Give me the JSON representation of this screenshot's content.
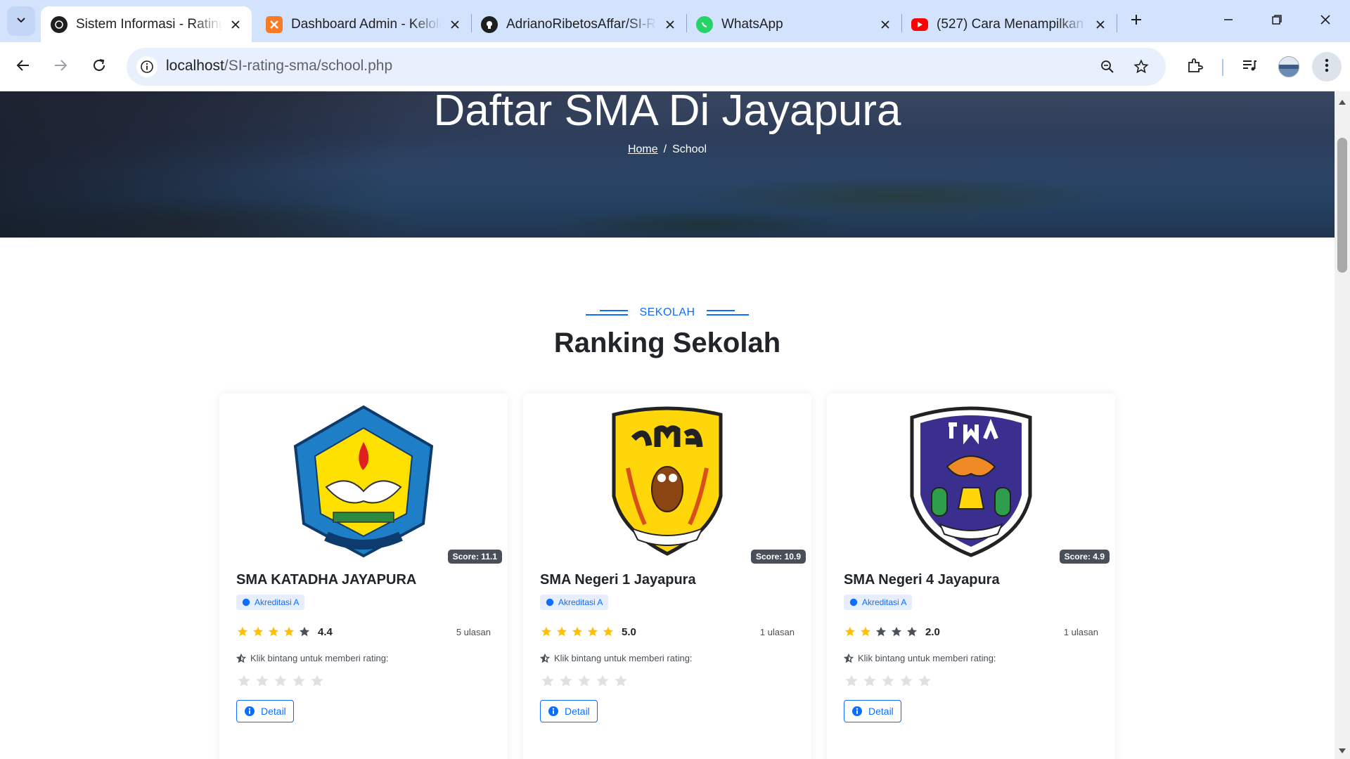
{
  "tabs": [
    {
      "title": "Sistem Informasi - Rating",
      "favicon": "page-icon",
      "active": true
    },
    {
      "title": "Dashboard Admin - Kelola",
      "favicon": "xampp-icon",
      "active": false
    },
    {
      "title": "AdrianoRibetosAffar/SI-R",
      "favicon": "github-icon",
      "active": false
    },
    {
      "title": "WhatsApp",
      "favicon": "whatsapp-icon",
      "active": false
    },
    {
      "title": "(527) Cara Menampilkan",
      "favicon": "youtube-icon",
      "active": false
    }
  ],
  "address": {
    "host": "localhost",
    "path": "/SI-rating-sma/school.php"
  },
  "hero": {
    "title": "Daftar SMA Di Jayapura",
    "breadcrumb": {
      "home": "Home",
      "separator": "/",
      "current": "School"
    }
  },
  "section": {
    "subtitle": "SEKOLAH",
    "title": "Ranking Sekolah"
  },
  "schools": [
    {
      "name": "SMA KATADHA JAYAPURA",
      "score": "Score: 11.1",
      "accreditation": "Akreditasi A",
      "rating": "4.4",
      "rating_value": 4.4,
      "reviews": "5 ulasan",
      "rate_hint": "Klik bintang untuk memberi rating:",
      "detail": "Detail",
      "logo": "sma-katadha-logo"
    },
    {
      "name": "SMA Negeri 1 Jayapura",
      "score": "Score: 10.9",
      "accreditation": "Akreditasi A",
      "rating": "5.0",
      "rating_value": 5.0,
      "reviews": "1 ulasan",
      "rate_hint": "Klik bintang untuk memberi rating:",
      "detail": "Detail",
      "logo": "sma-negeri-1-logo"
    },
    {
      "name": "SMA Negeri 4 Jayapura",
      "score": "Score: 4.9",
      "accreditation": "Akreditasi A",
      "rating": "2.0",
      "rating_value": 2.0,
      "reviews": "1 ulasan",
      "rate_hint": "Klik bintang untuk memberi rating:",
      "detail": "Detail",
      "logo": "sma-negeri-4-logo"
    }
  ],
  "colors": {
    "accent": "#0d6efd",
    "star_filled": "#ffc107",
    "star_empty": "#495057",
    "star_input": "#e0e0e0",
    "score_badge": "#495057",
    "tabbar": "#d3e3fd"
  }
}
